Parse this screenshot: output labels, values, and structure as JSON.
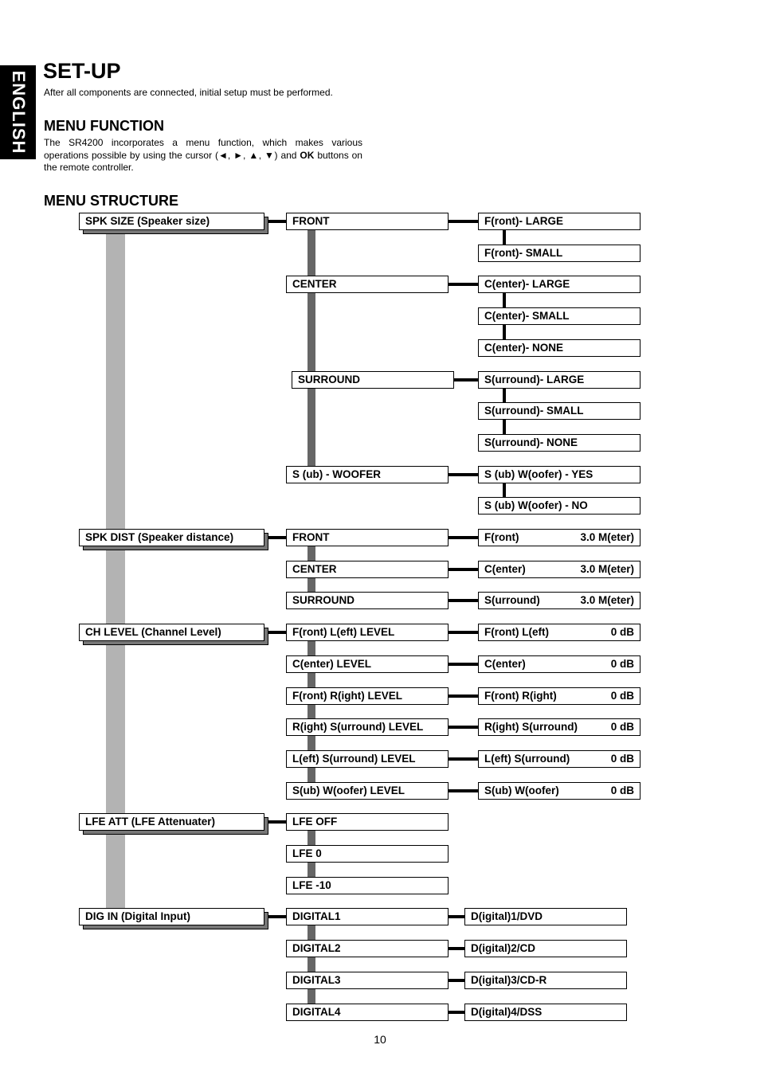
{
  "side_tab": "ENGLISH",
  "title": "SET-UP",
  "intro": "After all components are connected, initial setup must be performed.",
  "menu_function": {
    "heading": "MENU FUNCTION",
    "text": "The SR4200 incorporates a menu function, which makes various operations possible by using the cursor (◄, ►, ▲, ▼) and OK buttons on the remote controller."
  },
  "menu_structure": {
    "heading": "MENU STRUCTURE",
    "groups": [
      {
        "label": "SPK SIZE (Speaker size)",
        "items": [
          {
            "label": "FRONT",
            "options": [
              {
                "label": "F(ront)- LARGE"
              },
              {
                "label": "F(ront)- SMALL"
              }
            ]
          },
          {
            "label": "CENTER",
            "options": [
              {
                "label": "C(enter)- LARGE"
              },
              {
                "label": "C(enter)- SMALL"
              },
              {
                "label": "C(enter)- NONE"
              }
            ]
          },
          {
            "label": "SURROUND",
            "options": [
              {
                "label": "S(urround)- LARGE"
              },
              {
                "label": "S(urround)- SMALL"
              },
              {
                "label": "S(urround)- NONE"
              }
            ]
          },
          {
            "label": "S (ub) - WOOFER",
            "options": [
              {
                "label": "S (ub)  W(oofer) - YES"
              },
              {
                "label": "S (ub)  W(oofer) - NO"
              }
            ]
          }
        ]
      },
      {
        "label": "SPK DIST (Speaker distance)",
        "items": [
          {
            "label": "FRONT",
            "options": [
              {
                "label": "F(ront)",
                "value": "3.0 M(eter)"
              }
            ]
          },
          {
            "label": "CENTER",
            "options": [
              {
                "label": "C(enter)",
                "value": "3.0 M(eter)"
              }
            ]
          },
          {
            "label": "SURROUND",
            "options": [
              {
                "label": "S(urround)",
                "value": "3.0 M(eter)"
              }
            ]
          }
        ]
      },
      {
        "label": "CH LEVEL  (Channel Level)",
        "items": [
          {
            "label": "F(ront) L(eft) LEVEL",
            "options": [
              {
                "label": "F(ront) L(eft)",
                "value": "0 dB"
              }
            ]
          },
          {
            "label": "C(enter) LEVEL",
            "options": [
              {
                "label": "C(enter)",
                "value": "0 dB"
              }
            ]
          },
          {
            "label": "F(ront) R(ight) LEVEL",
            "options": [
              {
                "label": "F(ront) R(ight)",
                "value": "0 dB"
              }
            ]
          },
          {
            "label": "R(ight) S(urround) LEVEL",
            "options": [
              {
                "label": "R(ight) S(urround)",
                "value": "0 dB"
              }
            ]
          },
          {
            "label": "L(eft) S(urround) LEVEL",
            "options": [
              {
                "label": "L(eft) S(urround)",
                "value": "0 dB"
              }
            ]
          },
          {
            "label": "S(ub) W(oofer) LEVEL",
            "options": [
              {
                "label": "S(ub) W(oofer)",
                "value": "0 dB"
              }
            ]
          }
        ]
      },
      {
        "label": "LFE ATT  (LFE Attenuater)",
        "items": [
          {
            "label": "LFE OFF",
            "options": []
          },
          {
            "label": "LFE 0",
            "options": []
          },
          {
            "label": "LFE -10",
            "options": []
          }
        ]
      },
      {
        "label": "DIG IN  (Digital Input)",
        "items": [
          {
            "label": "DIGITAL1",
            "options": [
              {
                "label": "D(igital)1/DVD"
              }
            ]
          },
          {
            "label": "DIGITAL2",
            "options": [
              {
                "label": "D(igital)2/CD"
              }
            ]
          },
          {
            "label": "DIGITAL3",
            "options": [
              {
                "label": "D(igital)3/CD-R"
              }
            ]
          },
          {
            "label": "DIGITAL4",
            "options": [
              {
                "label": "D(igital)4/DSS"
              }
            ]
          }
        ]
      }
    ]
  },
  "page_number": "10"
}
